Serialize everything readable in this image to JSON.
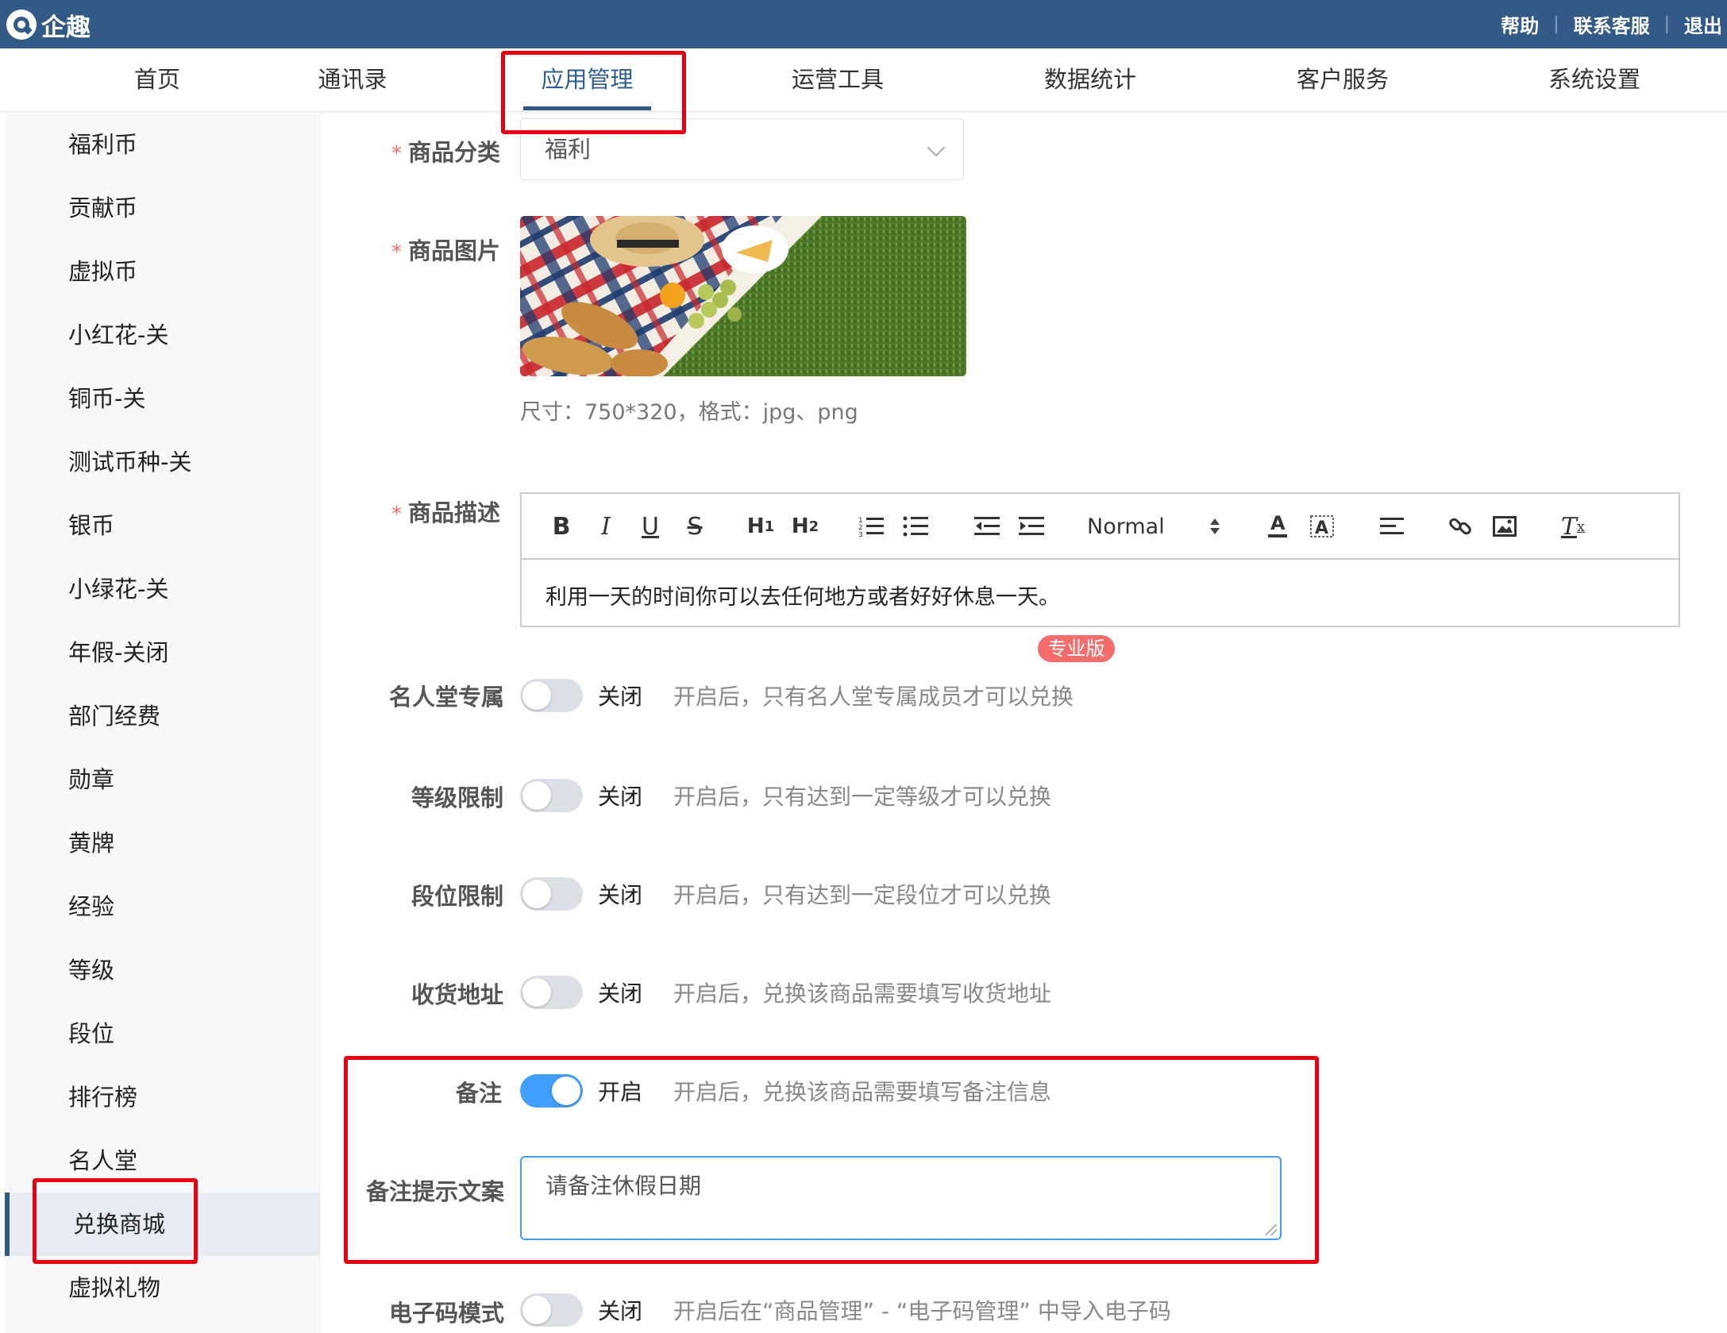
{
  "app": {
    "name": "企趣"
  },
  "toplinks": {
    "help": "帮助",
    "contact": "联系客服",
    "logout": "退出",
    "sep": "|"
  },
  "nav": {
    "items": [
      {
        "label": "首页"
      },
      {
        "label": "通讯录"
      },
      {
        "label": "应用管理",
        "active": true
      },
      {
        "label": "运营工具"
      },
      {
        "label": "数据统计"
      },
      {
        "label": "客户服务"
      },
      {
        "label": "系统设置"
      }
    ]
  },
  "sidebar": {
    "items": [
      {
        "label": "福利币"
      },
      {
        "label": "贡献币"
      },
      {
        "label": "虚拟币"
      },
      {
        "label": "小红花-关"
      },
      {
        "label": "铜币-关"
      },
      {
        "label": "测试币种-关"
      },
      {
        "label": "银币"
      },
      {
        "label": "小绿花-关"
      },
      {
        "label": "年假-关闭"
      },
      {
        "label": "部门经费"
      },
      {
        "label": "勋章"
      },
      {
        "label": "黄牌"
      },
      {
        "label": "经验"
      },
      {
        "label": "等级"
      },
      {
        "label": "段位"
      },
      {
        "label": "排行榜"
      },
      {
        "label": "名人堂"
      },
      {
        "label": "兑换商城",
        "active": true
      },
      {
        "label": "虚拟礼物"
      }
    ]
  },
  "form": {
    "required_mark": "*",
    "category": {
      "label": "商品分类",
      "value": "福利"
    },
    "image": {
      "label": "商品图片",
      "hint": "尺寸：750*320，格式：jpg、png"
    },
    "description": {
      "label": "商品描述",
      "heading_select": "Normal",
      "content": "利用一天的时间你可以去任何地方或者好好休息一天。",
      "toolbar_icons": [
        "bold-icon",
        "italic-icon",
        "underline-icon",
        "strikethrough-icon",
        "h1-icon",
        "h2-icon",
        "ordered-list-icon",
        "bullet-list-icon",
        "outdent-icon",
        "indent-icon",
        "font-color-icon",
        "background-color-icon",
        "align-icon",
        "link-icon",
        "image-icon",
        "clear-format-icon"
      ]
    },
    "pro_badge": "专业版",
    "switches": {
      "hall_of_fame": {
        "label": "名人堂专属",
        "state": "关闭",
        "on": false,
        "desc": "开启后，只有名人堂专属成员才可以兑换"
      },
      "level_limit": {
        "label": "等级限制",
        "state": "关闭",
        "on": false,
        "desc": "开启后，只有达到一定等级才可以兑换"
      },
      "rank_limit": {
        "label": "段位限制",
        "state": "关闭",
        "on": false,
        "desc": "开启后，只有达到一定段位才可以兑换"
      },
      "address": {
        "label": "收货地址",
        "state": "关闭",
        "on": false,
        "desc": "开启后，兑换该商品需要填写收货地址"
      },
      "remark": {
        "label": "备注",
        "state": "开启",
        "on": true,
        "desc": "开启后，兑换该商品需要填写备注信息"
      },
      "ecode": {
        "label": "电子码模式",
        "state": "关闭",
        "on": false,
        "desc": "开启后在“商品管理” - “电子码管理” 中导入电子码"
      }
    },
    "remark_prompt": {
      "label": "备注提示文案",
      "value": "请备注休假日期"
    }
  },
  "colors": {
    "topbar": "#335a87",
    "highlight_box": "#e60012",
    "switch_on": "#409eff",
    "pro_badge": "#f56c6c"
  }
}
